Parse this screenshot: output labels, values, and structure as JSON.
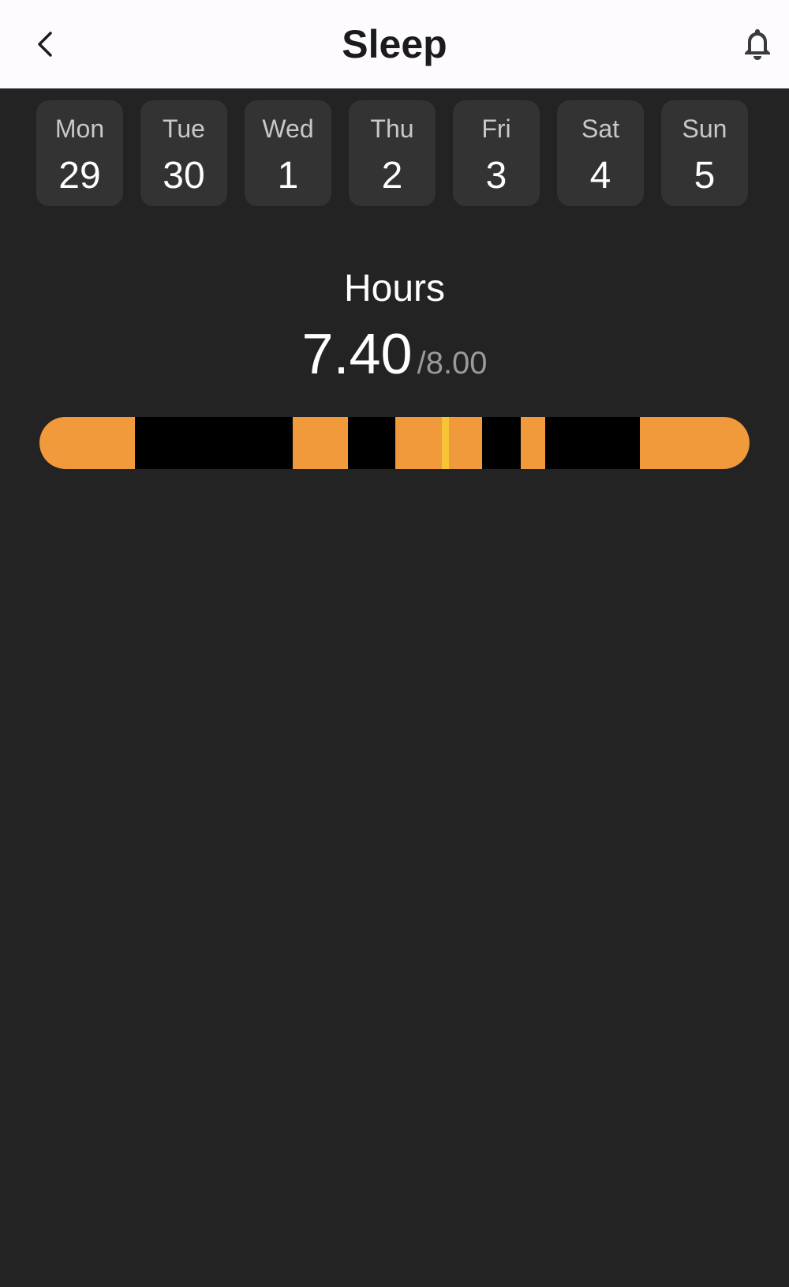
{
  "header": {
    "title": "Sleep",
    "back_icon": "chevron-left-icon",
    "notification_icon": "bell-icon"
  },
  "week": [
    {
      "day": "Mon",
      "date": "29"
    },
    {
      "day": "Tue",
      "date": "30"
    },
    {
      "day": "Wed",
      "date": "1"
    },
    {
      "day": "Thu",
      "date": "2"
    },
    {
      "day": "Fri",
      "date": "3"
    },
    {
      "day": "Sat",
      "date": "4"
    },
    {
      "day": "Sun",
      "date": "5"
    }
  ],
  "summary": {
    "label": "Hours",
    "value": "7.40",
    "goal": "/8.00"
  },
  "sleep_timeline": {
    "colors": {
      "awake": "#f09a3b",
      "deep": "#000000",
      "marker": "#f7c438"
    },
    "segments": [
      {
        "stage": "awake",
        "start": 0.0,
        "end": 0.134
      },
      {
        "stage": "deep",
        "start": 0.134,
        "end": 0.357
      },
      {
        "stage": "awake",
        "start": 0.357,
        "end": 0.434
      },
      {
        "stage": "deep",
        "start": 0.434,
        "end": 0.501
      },
      {
        "stage": "awake",
        "start": 0.501,
        "end": 0.567
      },
      {
        "stage": "marker",
        "start": 0.567,
        "end": 0.577
      },
      {
        "stage": "awake",
        "start": 0.577,
        "end": 0.623
      },
      {
        "stage": "deep",
        "start": 0.623,
        "end": 0.678
      },
      {
        "stage": "awake",
        "start": 0.678,
        "end": 0.712
      },
      {
        "stage": "deep",
        "start": 0.712,
        "end": 0.845
      },
      {
        "stage": "awake",
        "start": 0.845,
        "end": 1.0
      }
    ]
  }
}
